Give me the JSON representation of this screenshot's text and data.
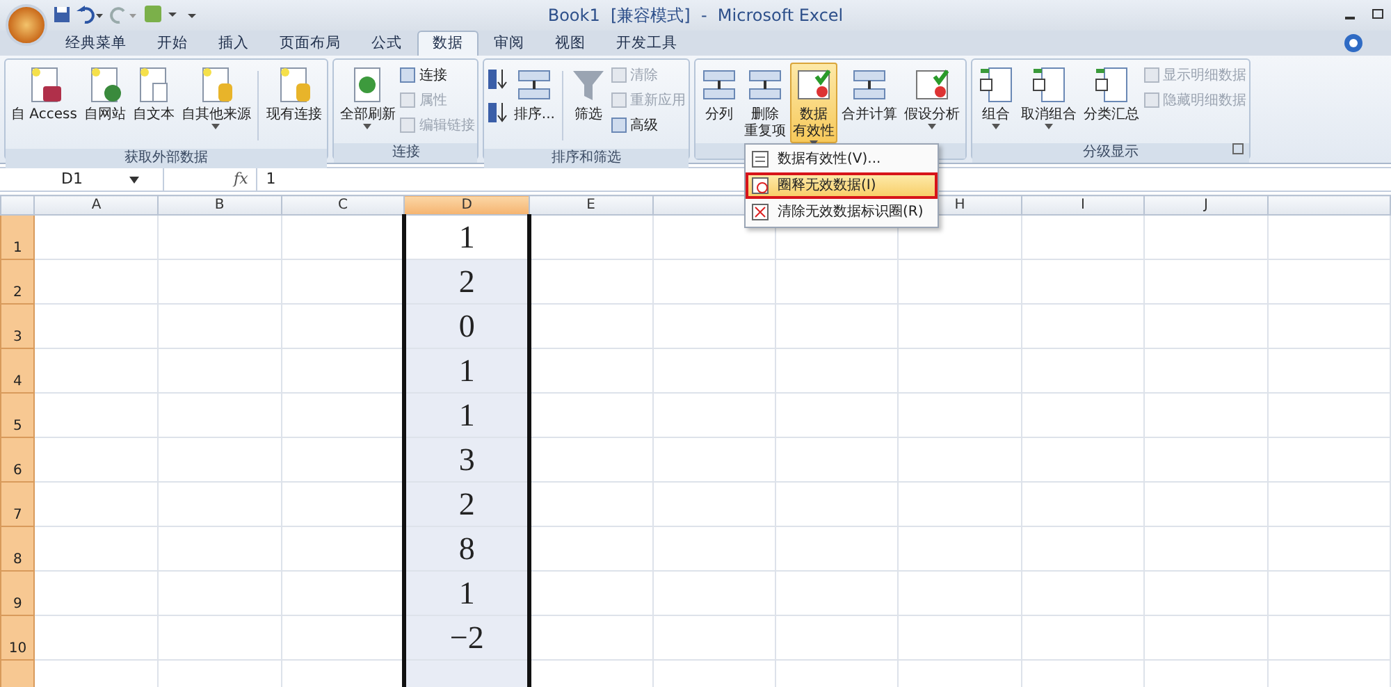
{
  "title_bar": {
    "title": "Book1  [兼容模式]  -  Microsoft Excel"
  },
  "tabs": [
    {
      "label": "经典菜单",
      "selected": false
    },
    {
      "label": "开始",
      "selected": false
    },
    {
      "label": "插入",
      "selected": false
    },
    {
      "label": "页面布局",
      "selected": false
    },
    {
      "label": "公式",
      "selected": false
    },
    {
      "label": "数据",
      "selected": true
    },
    {
      "label": "审阅",
      "selected": false
    },
    {
      "label": "视图",
      "selected": false
    },
    {
      "label": "开发工具",
      "selected": false
    }
  ],
  "ribbon": {
    "groups": [
      {
        "label": "获取外部数据",
        "buttons": [
          {
            "kind": "large",
            "lines": [
              "自 Access"
            ],
            "disabled": false,
            "dropdown": false,
            "pressed": false
          },
          {
            "kind": "large",
            "lines": [
              "自网站"
            ],
            "disabled": false,
            "dropdown": false,
            "pressed": false
          },
          {
            "kind": "large",
            "lines": [
              "自文本"
            ],
            "disabled": false,
            "dropdown": false,
            "pressed": false
          },
          {
            "kind": "large",
            "lines": [
              "自其他来源"
            ],
            "disabled": false,
            "dropdown": true,
            "pressed": false
          },
          {
            "kind": "separator"
          },
          {
            "kind": "large",
            "lines": [
              "现有连接"
            ],
            "disabled": false,
            "dropdown": false,
            "pressed": false
          }
        ]
      },
      {
        "label": "连接",
        "buttons": [
          {
            "kind": "large",
            "lines": [
              "全部刷新"
            ],
            "disabled": false,
            "dropdown": true,
            "pressed": false
          },
          {
            "kind": "small",
            "label": "连接",
            "disabled": false
          },
          {
            "kind": "small",
            "label": "属性",
            "disabled": true
          },
          {
            "kind": "small",
            "label": "编辑链接",
            "disabled": true
          }
        ]
      },
      {
        "label": "排序和筛选",
        "buttons": [
          {
            "kind": "icon",
            "disabled": false
          },
          {
            "kind": "icon",
            "disabled": false
          },
          {
            "kind": "large",
            "lines": [
              "排序..."
            ],
            "disabled": false,
            "dropdown": false,
            "pressed": false
          },
          {
            "kind": "separator"
          },
          {
            "kind": "large",
            "lines": [
              "筛选"
            ],
            "disabled": false,
            "dropdown": false,
            "pressed": false
          },
          {
            "kind": "small",
            "label": "清除",
            "disabled": true
          },
          {
            "kind": "small",
            "label": "重新应用",
            "disabled": true
          },
          {
            "kind": "small",
            "label": "高级",
            "disabled": false
          }
        ]
      },
      {
        "buttons": [
          {
            "kind": "large",
            "lines": [
              "分列"
            ],
            "disabled": false,
            "dropdown": false,
            "pressed": false
          },
          {
            "kind": "large",
            "lines": [
              "删除",
              "重复项"
            ],
            "disabled": false,
            "dropdown": false,
            "pressed": false
          },
          {
            "kind": "large",
            "lines": [
              "数据",
              "有效性"
            ],
            "disabled": false,
            "dropdown": true,
            "pressed": true
          },
          {
            "kind": "large",
            "lines": [
              "合并计算"
            ],
            "disabled": false,
            "dropdown": false,
            "pressed": false
          },
          {
            "kind": "large",
            "lines": [
              "假设分析"
            ],
            "disabled": false,
            "dropdown": true,
            "pressed": false
          }
        ]
      },
      {
        "label": "分级显示",
        "buttons": [
          {
            "kind": "large",
            "lines": [
              "组合"
            ],
            "disabled": false,
            "dropdown": true,
            "pressed": false
          },
          {
            "kind": "large",
            "lines": [
              "取消组合"
            ],
            "disabled": false,
            "dropdown": true,
            "pressed": false
          },
          {
            "kind": "large",
            "lines": [
              "分类汇总"
            ],
            "disabled": false,
            "dropdown": false,
            "pressed": false
          },
          {
            "kind": "small",
            "label": "显示明细数据",
            "disabled": true
          },
          {
            "kind": "small",
            "label": "隐藏明细数据",
            "disabled": true
          }
        ]
      }
    ]
  },
  "formula_bar": {
    "name_box": "D1",
    "function_label": "fx",
    "value": "1"
  },
  "sheet": {
    "columns": [
      {
        "kind": "header",
        "label": "A",
        "selected": false
      },
      {
        "kind": "header",
        "label": "B",
        "selected": false
      },
      {
        "kind": "header",
        "label": "C",
        "selected": false
      },
      {
        "kind": "header",
        "label": "D",
        "selected": true
      },
      {
        "kind": "header",
        "label": "E",
        "selected": false
      },
      {
        "kind": "covered"
      },
      {
        "kind": "covered"
      },
      {
        "kind": "header",
        "label": "H",
        "selected": false
      },
      {
        "kind": "header",
        "label": "I",
        "selected": false
      },
      {
        "kind": "header",
        "label": "J",
        "selected": false
      }
    ],
    "rows": [
      {
        "label": "1",
        "d": "1",
        "selected": true,
        "active": true
      },
      {
        "label": "2",
        "d": "2",
        "selected": true,
        "active": false
      },
      {
        "label": "3",
        "d": "0",
        "selected": true,
        "active": false
      },
      {
        "label": "4",
        "d": "1",
        "selected": true,
        "active": false
      },
      {
        "label": "5",
        "d": "1",
        "selected": true,
        "active": false
      },
      {
        "label": "6",
        "d": "3",
        "selected": true,
        "active": false
      },
      {
        "label": "7",
        "d": "2",
        "selected": true,
        "active": false
      },
      {
        "label": "8",
        "d": "8",
        "selected": true,
        "active": false
      },
      {
        "label": "9",
        "d": "1",
        "selected": true,
        "active": false
      },
      {
        "label": "10",
        "d": "−2",
        "selected": true,
        "active": false
      }
    ]
  },
  "menu": {
    "items": [
      {
        "label": "数据有效性(V)...",
        "selected": false
      },
      {
        "label": "圈释无效数据(I)",
        "selected": true
      },
      {
        "label": "清除无效数据标识圈(R)",
        "selected": false
      }
    ]
  }
}
